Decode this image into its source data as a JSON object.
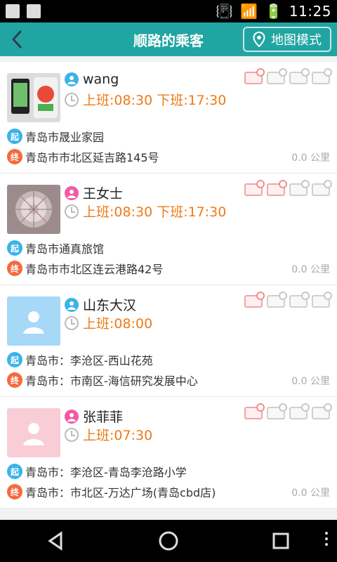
{
  "status": {
    "time": "11:25"
  },
  "header": {
    "title": "顺路的乘客",
    "map_button": "地图模式"
  },
  "cards": [
    {
      "name": "wang",
      "gender_color": "blue",
      "time": "上班:08:30 下班:17:30",
      "start_badge": "起",
      "start": "青岛市晟业家园",
      "end_badge": "终",
      "end": "青岛市市北区延吉路145号",
      "distance": "0.0 公里"
    },
    {
      "name": "王女士",
      "gender_color": "pink",
      "time": "上班:08:30 下班:17:30",
      "start_badge": "起",
      "start": "青岛市通真旅馆",
      "end_badge": "终",
      "end": "青岛市市北区连云港路42号",
      "distance": "0.0 公里"
    },
    {
      "name": "山东大汉",
      "gender_color": "blue",
      "time": "上班:08:00",
      "start_badge": "起",
      "start": "青岛市：李沧区-西山花苑",
      "end_badge": "终",
      "end": "青岛市：市南区-海信研究发展中心",
      "distance": "0.0 公里"
    },
    {
      "name": "张菲菲",
      "gender_color": "pink",
      "time": "上班:07:30",
      "start_badge": "起",
      "start": "青岛市：李沧区-青岛李沧路小学",
      "end_badge": "终",
      "end": "青岛市：市北区-万达广场(青岛cbd店)",
      "distance": "0.0 公里"
    }
  ],
  "colors": {
    "teal": "#21a5a2",
    "orange_time": "#ef7a16",
    "start_pin": "#3bb3e8",
    "end_pin": "#f36b3f"
  },
  "icons": {
    "back": "chevron-left-icon",
    "map": "location-pin-icon",
    "user": "user-icon",
    "clock": "clock-icon"
  }
}
